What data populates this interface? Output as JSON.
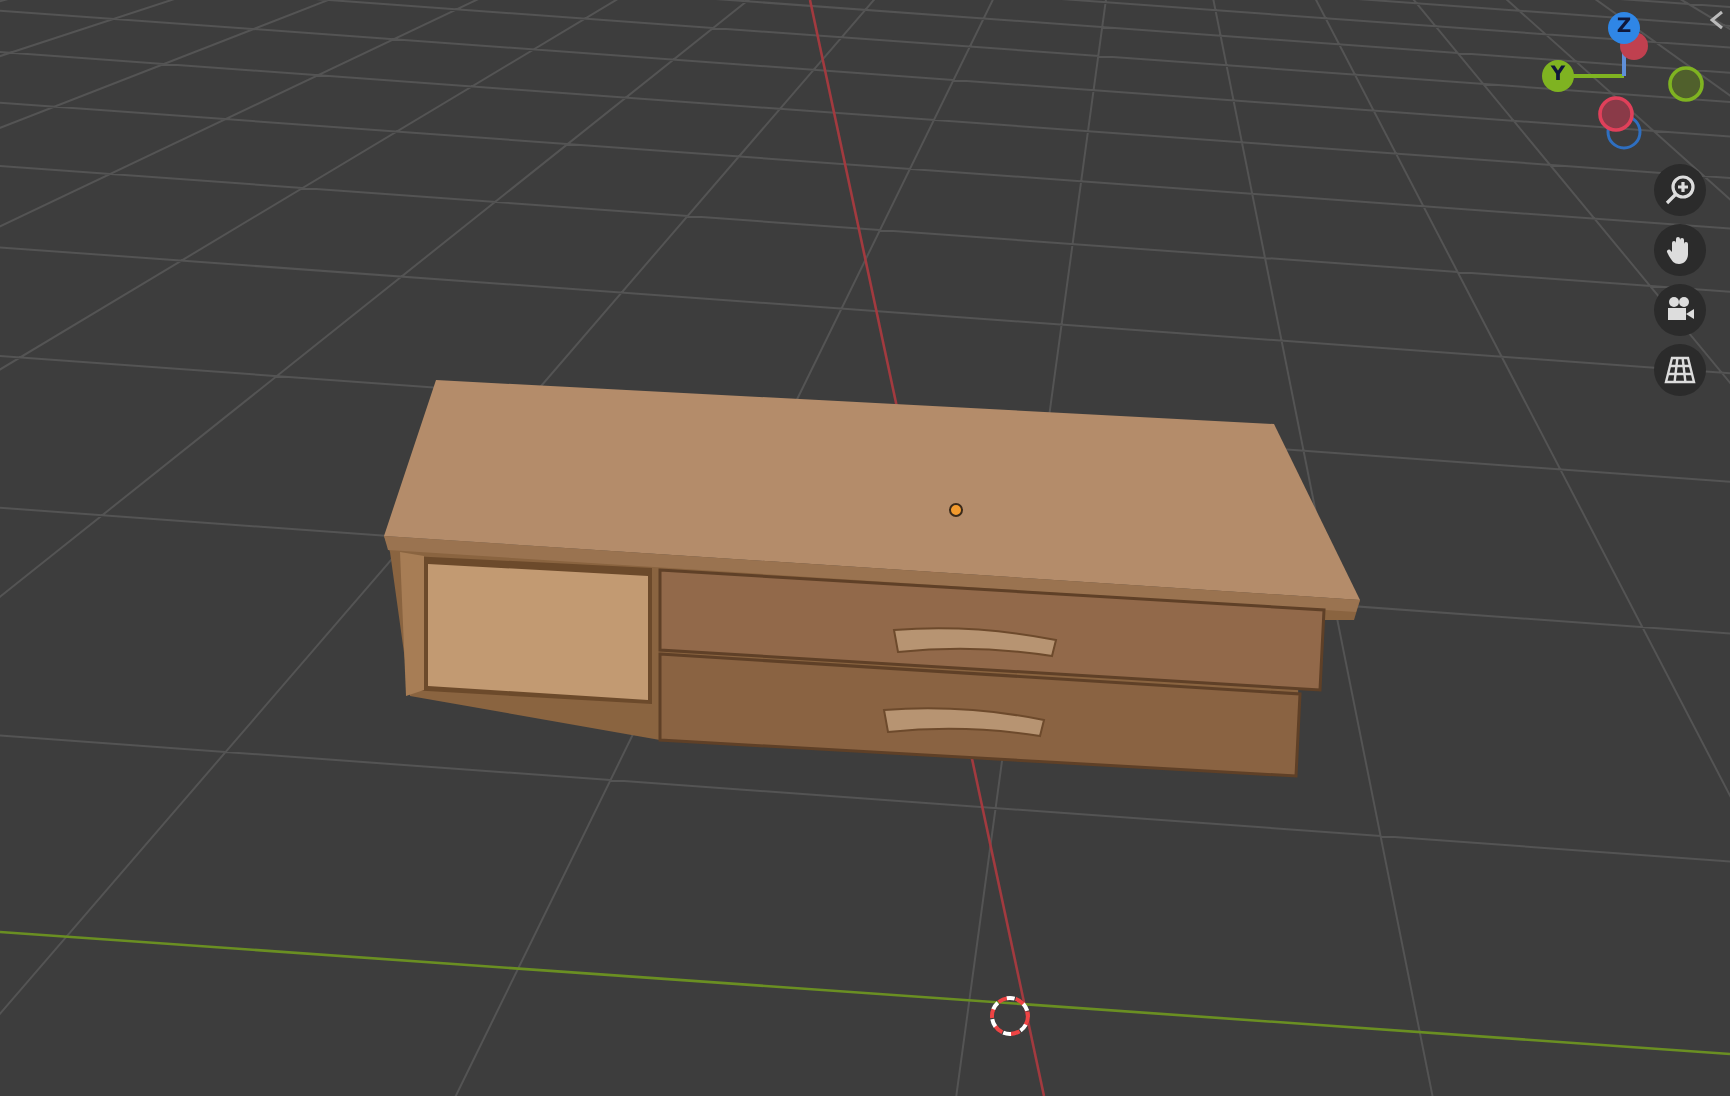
{
  "viewport": {
    "gizmo": {
      "axes": [
        {
          "label": "Z",
          "color": "#2f86e6"
        },
        {
          "label": "Y",
          "color": "#7fb321"
        }
      ]
    },
    "nav_buttons": [
      {
        "kind": "zoom"
      },
      {
        "kind": "pan"
      },
      {
        "kind": "camera"
      },
      {
        "kind": "grid"
      }
    ]
  }
}
